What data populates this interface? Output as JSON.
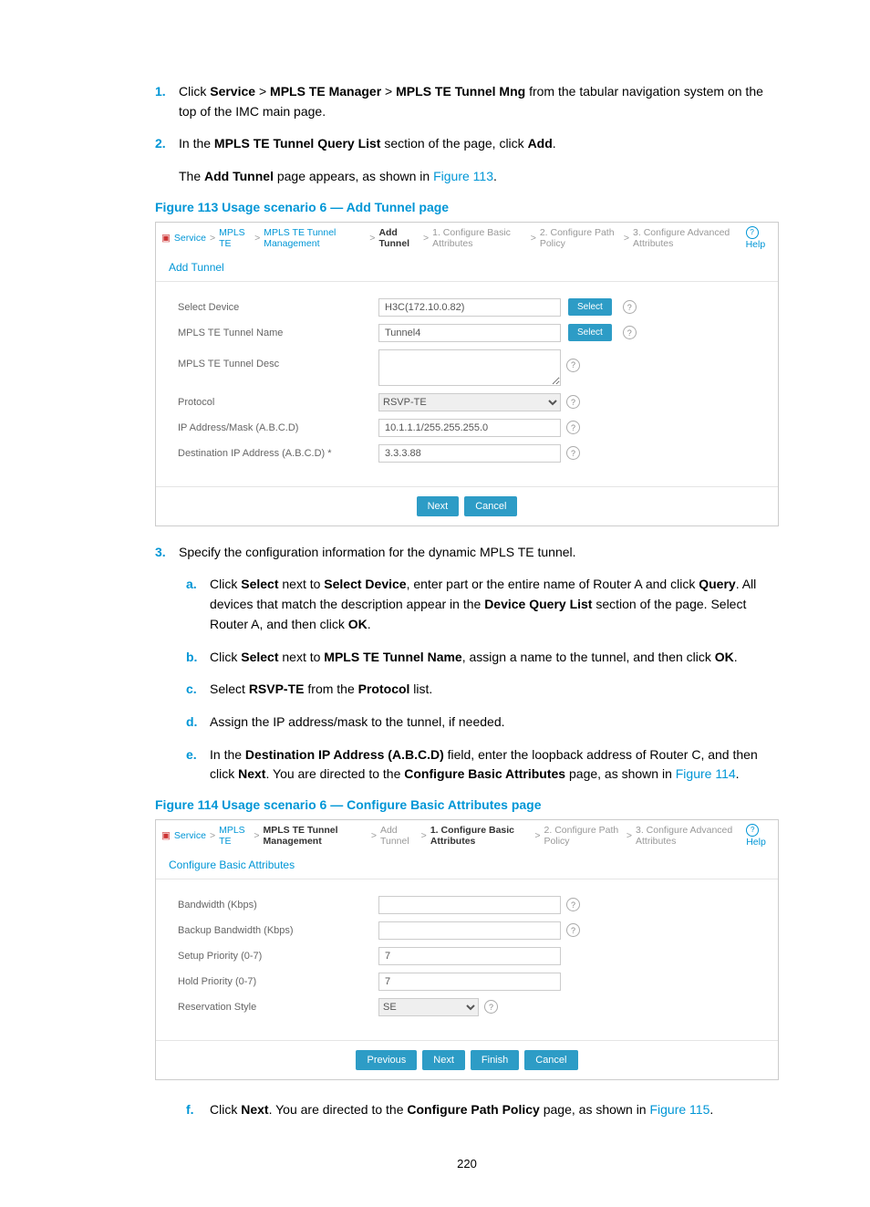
{
  "step1": {
    "num": "1.",
    "text_before_service": "Click ",
    "service": "Service",
    "gt1": " > ",
    "mpls_mgr": "MPLS TE Manager",
    "gt2": " > ",
    "mpls_mng": "MPLS TE Tunnel Mng",
    "text_after": " from the tabular navigation system on the top of the IMC main page."
  },
  "step2": {
    "num": "2.",
    "text1_a": "In the ",
    "b1": "MPLS TE Tunnel Query List",
    "text1_b": " section of the page, click ",
    "b2": "Add",
    "text1_c": ".",
    "follow_a": "The ",
    "follow_b": "Add Tunnel",
    "follow_c": " page appears, as shown in ",
    "follow_link": "Figure 113",
    "follow_d": "."
  },
  "fig113": {
    "caption": "Figure 113 Usage scenario 6 — Add Tunnel page",
    "crumb": {
      "svc": "Service",
      "mpls": "MPLS TE",
      "mgmt": "MPLS TE Tunnel Management",
      "add": "Add Tunnel",
      "s1": "1. Configure Basic Attributes",
      "s2": "2. Configure Path Policy",
      "s3": "3. Configure Advanced Attributes",
      "help": "Help"
    },
    "panel": "Add Tunnel",
    "rows": {
      "device_label": "Select Device",
      "device_value": "H3C(172.10.0.82)",
      "name_label": "MPLS TE Tunnel Name",
      "name_value": "Tunnel4",
      "desc_label": "MPLS TE Tunnel Desc",
      "desc_value": "",
      "protocol_label": "Protocol",
      "protocol_value": "RSVP-TE",
      "ipmask_label": "IP Address/Mask (A.B.C.D)",
      "ipmask_value": "10.1.1.1/255.255.255.0",
      "dest_label": "Destination IP Address (A.B.C.D) *",
      "dest_value": "3.3.3.88"
    },
    "btns": {
      "select": "Select",
      "next": "Next",
      "cancel": "Cancel"
    }
  },
  "step3": {
    "num": "3.",
    "text": "Specify the configuration information for the dynamic MPLS TE tunnel.",
    "a": {
      "letter": "a.",
      "t1": "Click ",
      "b1": "Select",
      "t2": " next to ",
      "b2": "Select Device",
      "t3": ", enter part or the entire name of Router A and click ",
      "b3": "Query",
      "t4": ". All devices that match the description appear in the ",
      "b4": "Device Query List",
      "t5": " section of the page. Select Router A, and then click ",
      "b5": "OK",
      "t6": "."
    },
    "b": {
      "letter": "b.",
      "t1": "Click ",
      "b1": "Select",
      "t2": " next to ",
      "b2": "MPLS TE Tunnel Name",
      "t3": ", assign a name to the tunnel, and then click ",
      "b3": "OK",
      "t4": "."
    },
    "c": {
      "letter": "c.",
      "t1": "Select ",
      "b1": "RSVP-TE",
      "t2": " from the ",
      "b2": "Protocol",
      "t3": " list."
    },
    "d": {
      "letter": "d.",
      "t1": "Assign the IP address/mask to the tunnel, if needed."
    },
    "e": {
      "letter": "e.",
      "t1": "In the ",
      "b1": "Destination IP Address (A.B.C.D)",
      "t2": " field, enter the loopback address of Router C, and then click ",
      "b2": "Next",
      "t3": ". You are directed to the ",
      "b3": "Configure Basic Attributes",
      "t4": " page, as shown in ",
      "link": "Figure 114",
      "t5": "."
    }
  },
  "fig114": {
    "caption": "Figure 114 Usage scenario 6 — Configure Basic Attributes page",
    "crumb": {
      "svc": "Service",
      "mpls": "MPLS TE",
      "mgmt": "MPLS TE Tunnel Management",
      "add": "Add Tunnel",
      "s1": "1. Configure Basic Attributes",
      "s2": "2. Configure Path Policy",
      "s3": "3. Configure Advanced Attributes",
      "help": "Help"
    },
    "panel": "Configure Basic Attributes",
    "rows": {
      "bw_label": "Bandwidth (Kbps)",
      "bw_value": "",
      "bbw_label": "Backup Bandwidth (Kbps)",
      "bbw_value": "",
      "setup_label": "Setup Priority (0-7)",
      "setup_value": "7",
      "hold_label": "Hold Priority (0-7)",
      "hold_value": "7",
      "res_label": "Reservation Style",
      "res_value": "SE"
    },
    "btns": {
      "previous": "Previous",
      "next": "Next",
      "finish": "Finish",
      "cancel": "Cancel"
    }
  },
  "stepf": {
    "letter": "f.",
    "t1": "Click ",
    "b1": "Next",
    "t2": ". You are directed to the ",
    "b2": "Configure Path Policy",
    "t3": " page, as shown in ",
    "link": "Figure 115",
    "t4": "."
  },
  "pagenum": "220"
}
